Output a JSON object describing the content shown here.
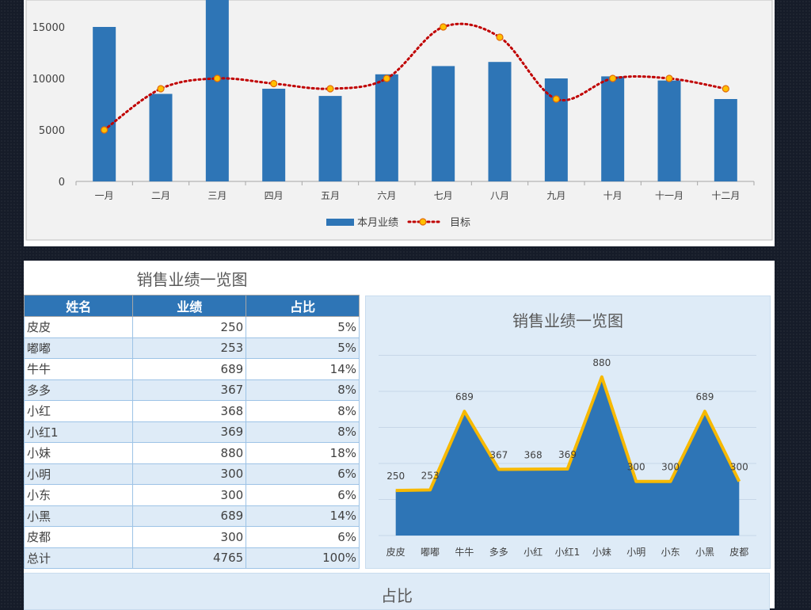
{
  "chart_data": [
    {
      "type": "bar",
      "title": "",
      "categories": [
        "一月",
        "二月",
        "三月",
        "四月",
        "五月",
        "六月",
        "七月",
        "八月",
        "九月",
        "十月",
        "十一月",
        "十二月"
      ],
      "series": [
        {
          "name": "本月业绩",
          "type": "bar",
          "color": "#2e75b6",
          "values": [
            15000,
            8500,
            17800,
            9000,
            8300,
            10400,
            11200,
            11600,
            10000,
            10200,
            9800,
            8000
          ]
        },
        {
          "name": "目标",
          "type": "line-dotted",
          "color": "#c00000",
          "values": [
            5000,
            9000,
            10000,
            9500,
            9000,
            10000,
            15000,
            14000,
            8000,
            10000,
            10000,
            9000
          ]
        }
      ],
      "ylim": [
        0,
        17000
      ],
      "yticks": [
        "0",
        "5000",
        "10000",
        "15000"
      ],
      "grid": false,
      "legend": "bottom"
    },
    {
      "type": "area",
      "title": "销售业绩一览图",
      "categories": [
        "皮皮",
        "嘟嘟",
        "牛牛",
        "多多",
        "小红",
        "小红1",
        "小妹",
        "小明",
        "小东",
        "小黑",
        "皮都"
      ],
      "series": [
        {
          "name": "业绩",
          "color": "#2e75b6",
          "line_color": "#f7b900",
          "values": [
            250,
            253,
            689,
            367,
            368,
            369,
            880,
            300,
            300,
            689,
            300
          ],
          "labels": [
            "250",
            "253",
            "689",
            "367",
            "368",
            "369",
            "880",
            "300",
            "300",
            "689",
            "300"
          ]
        }
      ],
      "ylim": [
        0,
        1000
      ],
      "grid": true
    }
  ],
  "table": {
    "title": "销售业绩一览图",
    "headers": [
      "姓名",
      "业绩",
      "占比"
    ],
    "rows": [
      [
        "皮皮",
        "250",
        "5%"
      ],
      [
        "嘟嘟",
        "253",
        "5%"
      ],
      [
        "牛牛",
        "689",
        "14%"
      ],
      [
        "多多",
        "367",
        "8%"
      ],
      [
        "小红",
        "368",
        "8%"
      ],
      [
        "小红1",
        "369",
        "8%"
      ],
      [
        "小妹",
        "880",
        "18%"
      ],
      [
        "小明",
        "300",
        "6%"
      ],
      [
        "小东",
        "300",
        "6%"
      ],
      [
        "小黑",
        "689",
        "14%"
      ],
      [
        "皮都",
        "300",
        "6%"
      ],
      [
        "总计",
        "4765",
        "100%"
      ]
    ]
  },
  "pie_panel": {
    "title": "占比"
  }
}
